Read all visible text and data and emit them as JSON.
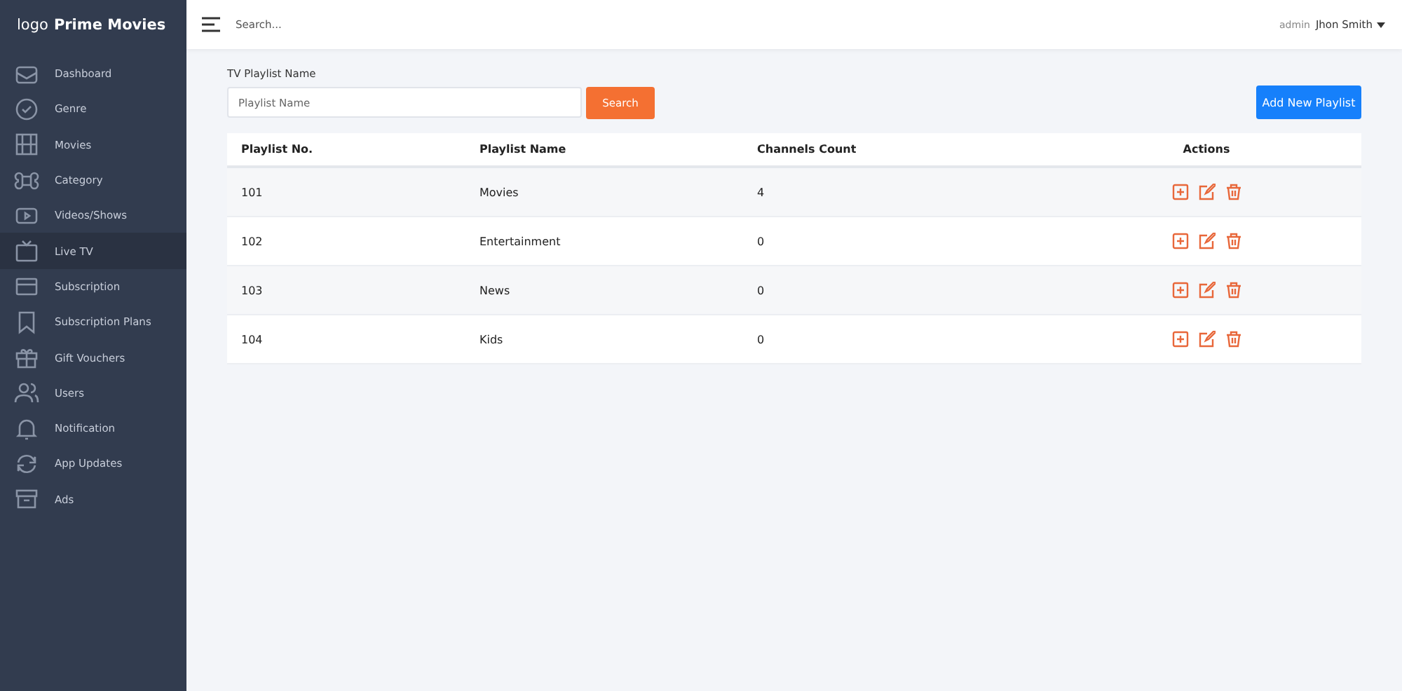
{
  "brand": {
    "logo": "logo",
    "name": "Prime Movies"
  },
  "sidebar": {
    "items": [
      {
        "label": "Dashboard",
        "selected": false
      },
      {
        "label": "Genre",
        "selected": false
      },
      {
        "label": "Movies",
        "selected": false
      },
      {
        "label": "Category",
        "selected": false
      },
      {
        "label": "Videos/Shows",
        "selected": false
      },
      {
        "label": "Live TV",
        "selected": true
      },
      {
        "label": "Subscription",
        "selected": false
      },
      {
        "label": "Subscription Plans",
        "selected": false
      },
      {
        "label": "Gift Vouchers",
        "selected": false
      },
      {
        "label": "Users",
        "selected": false
      },
      {
        "label": "Notification",
        "selected": false
      },
      {
        "label": "App Updates",
        "selected": false
      },
      {
        "label": "Ads",
        "selected": false
      }
    ]
  },
  "topbar": {
    "search_placeholder": "Search...",
    "role": "admin",
    "user": "Jhon Smith"
  },
  "filter": {
    "label": "TV Playlist Name",
    "placeholder": "Playlist Name",
    "button": "Search"
  },
  "add_button": "Add New Playlist",
  "table": {
    "columns": [
      "Playlist No.",
      "Playlist Name",
      "Channels Count",
      "Actions"
    ],
    "rows": [
      {
        "number": "101",
        "name": "Movies",
        "count": "4"
      },
      {
        "number": "102",
        "name": "Entertainment",
        "count": "0"
      },
      {
        "number": "103",
        "name": "News",
        "count": "0"
      },
      {
        "number": "104",
        "name": "Kids",
        "count": "0"
      }
    ]
  }
}
